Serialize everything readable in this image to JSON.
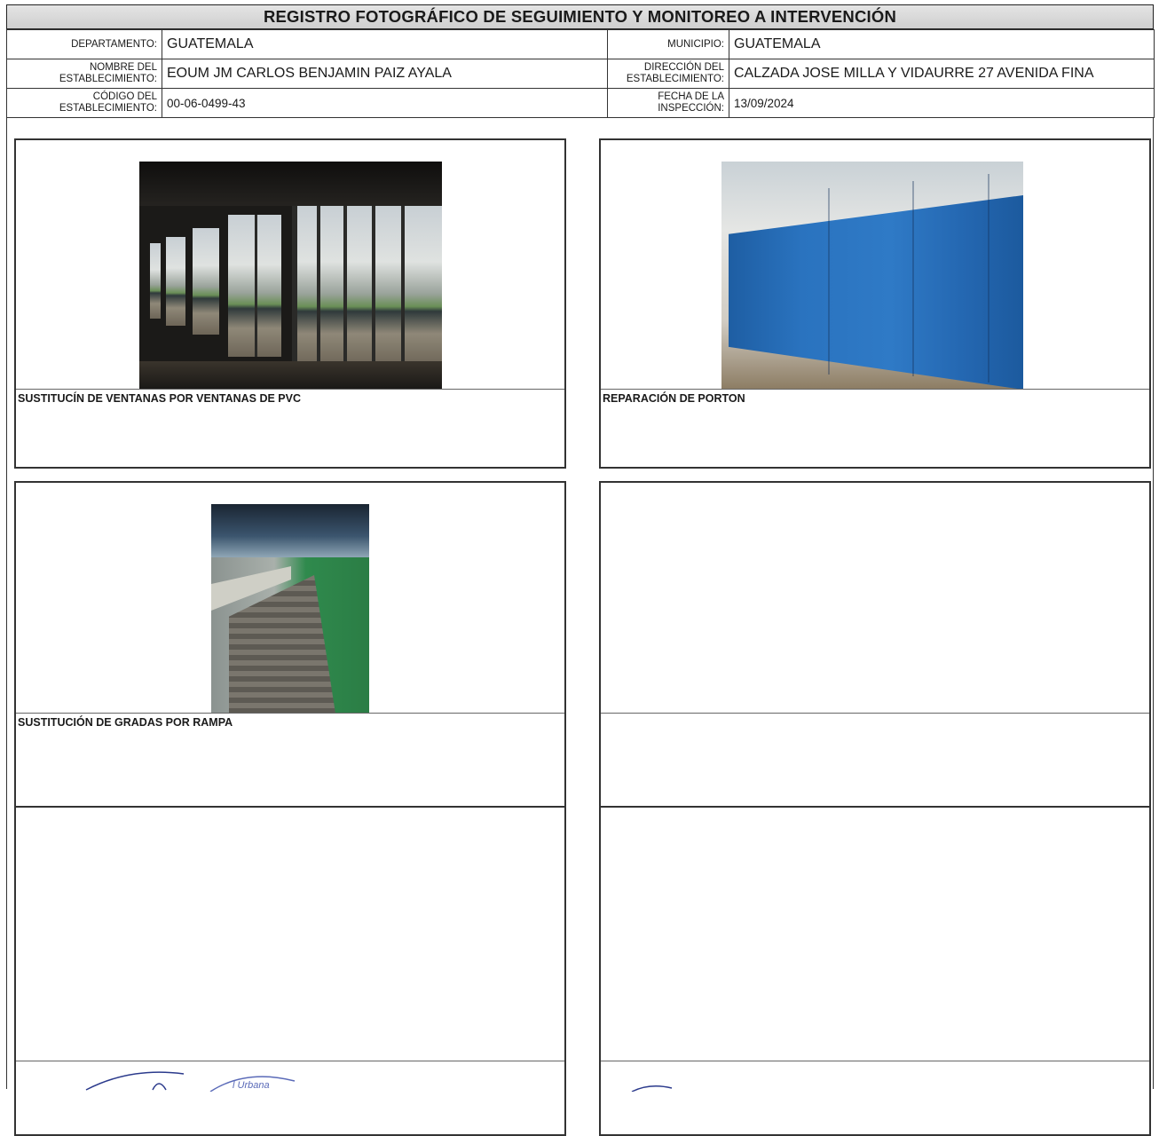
{
  "title": "REGISTRO FOTOGRÁFICO DE SEGUIMIENTO Y MONITOREO A INTERVENCIÓN",
  "header": {
    "departamento_label": "DEPARTAMENTO:",
    "departamento_value": "GUATEMALA",
    "municipio_label": "MUNICIPIO:",
    "municipio_value": "GUATEMALA",
    "nombre_label_1": "NOMBRE DEL",
    "nombre_label_2": "ESTABLECIMIENTO:",
    "nombre_value": "EOUM JM CARLOS BENJAMIN PAIZ AYALA",
    "direccion_label_1": "DIRECCIÓN DEL",
    "direccion_label_2": "ESTABLECIMIENTO:",
    "direccion_value": "CALZADA JOSE MILLA Y VIDAURRE 27 AVENIDA FINA",
    "codigo_label_1": "CÓDIGO DEL",
    "codigo_label_2": "ESTABLECIMIENTO:",
    "codigo_value": "00-06-0499-43",
    "fecha_label_1": "FECHA DE LA",
    "fecha_label_2": "INSPECCIÓN:",
    "fecha_value": "13/09/2024"
  },
  "photos": [
    {
      "caption": "SUSTITUCÍN DE VENTANAS POR VENTANAS DE PVC"
    },
    {
      "caption": "REPARACIÓN DE PORTON"
    },
    {
      "caption": "SUSTITUCIÓN DE GRADAS POR RAMPA"
    },
    {
      "caption": ""
    },
    {
      "caption": ""
    },
    {
      "caption": ""
    }
  ],
  "stamp_text": "l Urbana"
}
